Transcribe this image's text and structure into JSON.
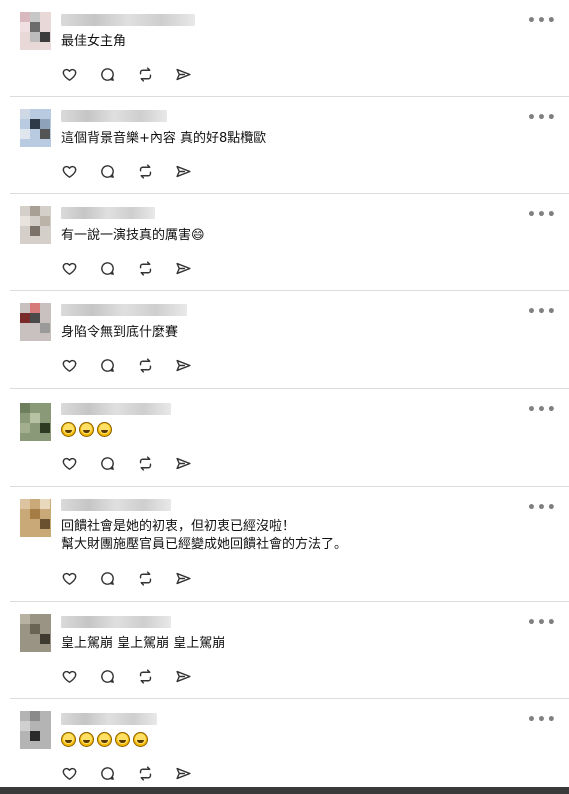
{
  "more_label": "•••",
  "comments": [
    {
      "text": "最佳女主角",
      "emoji_count": 0
    },
    {
      "text": "這個背景音樂+內容 真的好8點欖歐",
      "emoji_count": 0
    },
    {
      "text": "有一說一演技真的厲害😄",
      "emoji_count": 0
    },
    {
      "text": "身陷令無到底什麼賽",
      "emoji_count": 0
    },
    {
      "text": "",
      "emoji_count": 3
    },
    {
      "text": "回饋社會是她的初衷，但初衷已經沒啦！\n幫大財團施壓官員已經變成她回饋社會的方法了。",
      "emoji_count": 0
    },
    {
      "text": "皇上駕崩 皇上駕崩 皇上駕崩",
      "emoji_count": 0
    },
    {
      "text": "",
      "emoji_count": 5
    }
  ],
  "action_icons": [
    "heart-icon",
    "comment-icon",
    "repost-icon",
    "share-icon"
  ],
  "colors": {
    "divider": "#dcdcdc",
    "icon": "#333333",
    "more": "#808080"
  }
}
